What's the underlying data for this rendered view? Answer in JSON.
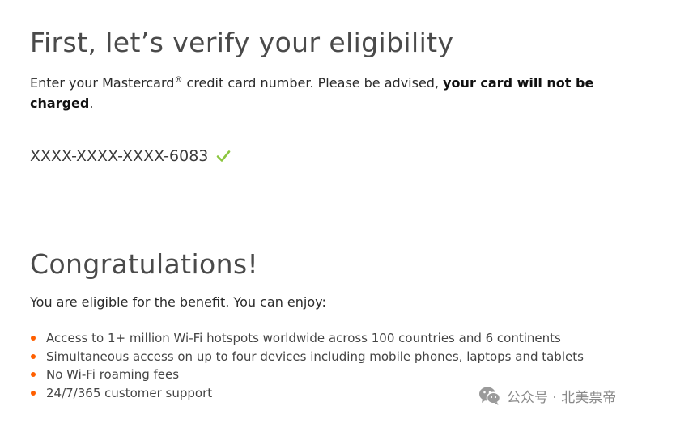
{
  "eligibility": {
    "title": "First, let’s verify your eligibility",
    "intro_text": "Enter your Mastercard",
    "intro_registered": "®",
    "intro_text2": " credit card number. Please be advised, ",
    "intro_bold": "your card will not be charged",
    "intro_end": ".",
    "card_number": "XXXX-XXXX-XXXX-6083",
    "verified_icon": "check-icon",
    "verified_color": "#8cc63f"
  },
  "result": {
    "title": "Congratulations!",
    "subtitle": "You are eligible for the benefit. You can enjoy:",
    "bullet_color": "#ff5f00",
    "benefits": [
      "Access to 1+ million Wi-Fi hotspots worldwide across 100 countries and 6 continents",
      "Simultaneous access on up to four devices including mobile phones, laptops and tablets",
      "No Wi-Fi roaming fees",
      "24/7/365 customer support"
    ]
  },
  "watermark": {
    "icon": "wechat-icon",
    "text": "公众号 · 北美票帝"
  }
}
